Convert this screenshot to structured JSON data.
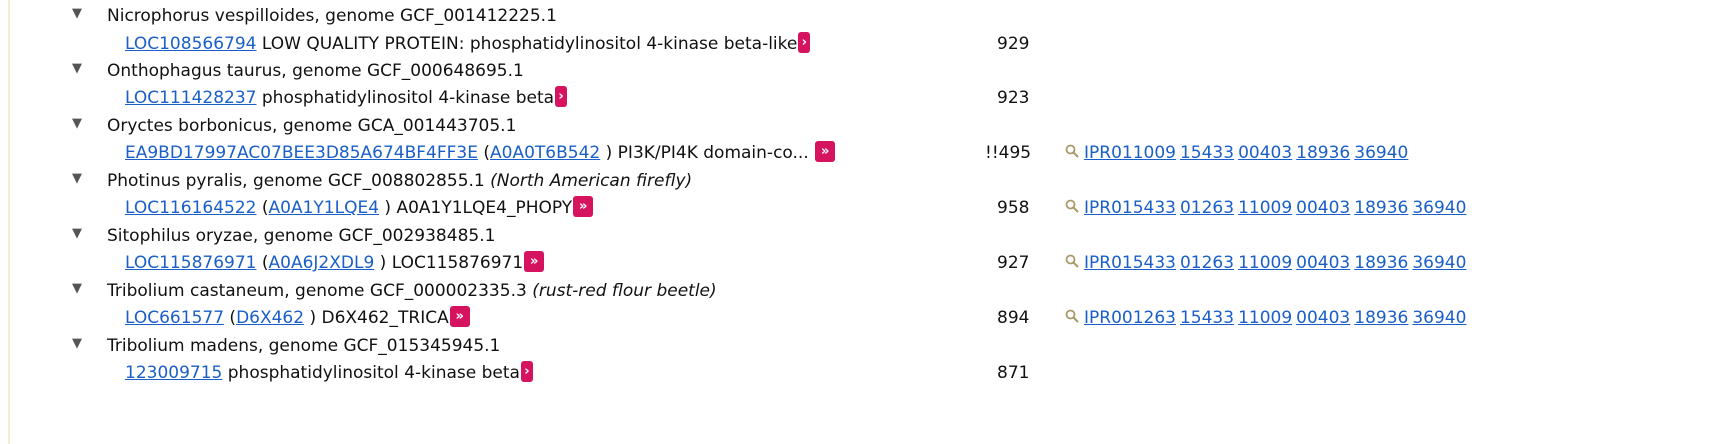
{
  "icons": {
    "expand": "triangle-down-icon",
    "more": "chevron-right-icon",
    "search": "magnifier-icon"
  },
  "colors": {
    "link": "#1a5fc9",
    "badge": "#d6135f",
    "search_icon": "#a89a6a"
  },
  "rows": [
    {
      "organism": "Nicrophorus vespilloides, genome GCF_001412225.1",
      "common_name": "",
      "locus": "LOC108566794",
      "desc": " LOW QUALITY PROTEIN: phosphatidylinositol 4-kinase beta-like",
      "badge": "›",
      "length": "929"
    },
    {
      "organism": "Onthophagus taurus, genome GCF_000648695.1",
      "common_name": "",
      "locus": "LOC111428237",
      "desc": " phosphatidylinositol 4-kinase beta",
      "badge": "›",
      "length": "923"
    },
    {
      "organism": "Oryctes borbonicus, genome GCA_001443705.1",
      "common_name": "",
      "locus": "EA9BD17997AC07BEE3D85A674BF4FF3E",
      "uniprot_open": " (",
      "uniprot": "A0A0T6B542",
      "desc": " ) PI3K/PI4K domain-co...",
      "badge": "»",
      "length": "!!495",
      "ipr": [
        "IPR011009",
        "15433",
        "00403",
        "18936",
        "36940"
      ]
    },
    {
      "organism": "Photinus pyralis, genome GCF_008802855.1 ",
      "common_name": "(North American firefly)",
      "locus": "LOC116164522",
      "uniprot_open": " (",
      "uniprot": "A0A1Y1LQE4",
      "desc": " ) A0A1Y1LQE4_PHOPY",
      "badge": "»",
      "length": "958",
      "ipr": [
        "IPR015433",
        "01263",
        "11009",
        "00403",
        "18936",
        "36940"
      ]
    },
    {
      "organism": "Sitophilus oryzae, genome GCF_002938485.1",
      "common_name": "",
      "locus": "LOC115876971",
      "uniprot_open": " (",
      "uniprot": "A0A6J2XDL9",
      "desc": " ) LOC115876971",
      "badge": "»",
      "length": "927",
      "ipr": [
        "IPR015433",
        "01263",
        "11009",
        "00403",
        "18936",
        "36940"
      ]
    },
    {
      "organism": "Tribolium castaneum, genome GCF_000002335.3 ",
      "common_name": "(rust-red flour beetle)",
      "locus": "LOC661577",
      "uniprot_open": " (",
      "uniprot": "D6X462",
      "desc": " ) D6X462_TRICA",
      "badge": "»",
      "length": "894",
      "ipr": [
        "IPR001263",
        "15433",
        "11009",
        "00403",
        "18936",
        "36940"
      ]
    },
    {
      "organism": "Tribolium madens, genome GCF_015345945.1",
      "common_name": "",
      "locus": "123009715",
      "desc": " phosphatidylinositol 4-kinase beta",
      "badge": "›",
      "length": "871"
    }
  ]
}
